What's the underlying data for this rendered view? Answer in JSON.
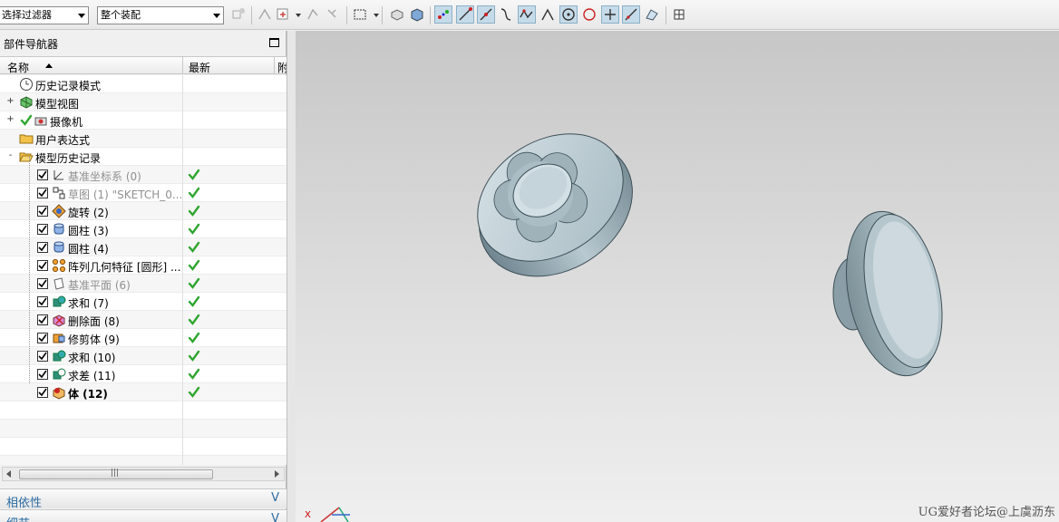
{
  "toolbar": {
    "filter_combo": "选择过滤器",
    "assembly_combo": "整个装配",
    "tools": [
      "snap-icon",
      "point-icon",
      "point-filter-icon",
      "section-icon",
      "cut-icon",
      "box-select-icon",
      "shaded-icon",
      "solid-icon",
      "endpoint-icon",
      "line-icon",
      "line-2-icon",
      "curve-icon",
      "spline-icon",
      "arc-icon",
      "circle-center-icon",
      "circle-icon",
      "cross-icon",
      "tangent-icon",
      "quadrant-icon",
      "grid-icon"
    ]
  },
  "navigator": {
    "title": "部件导航器",
    "columns": {
      "name": "名称",
      "latest": "最新",
      "extra": "附"
    },
    "items": [
      {
        "label": "历史记录模式",
        "icon": "clock-icon",
        "checkbox": false,
        "expander": "",
        "dim": false,
        "bold": false,
        "latest": false
      },
      {
        "label": "模型视图",
        "icon": "model-views-icon",
        "checkbox": false,
        "expander": "+",
        "dim": false,
        "bold": false,
        "latest": false
      },
      {
        "label": "摄像机",
        "icon": "camera-icon",
        "checkbox": false,
        "expander": "+",
        "dim": false,
        "bold": false,
        "latest": false
      },
      {
        "label": "用户表达式",
        "icon": "folder-icon",
        "checkbox": false,
        "expander": "",
        "dim": false,
        "bold": false,
        "latest": false
      },
      {
        "label": "模型历史记录",
        "icon": "folder-open-icon",
        "checkbox": false,
        "expander": "-",
        "dim": false,
        "bold": false,
        "latest": false
      },
      {
        "label": "基准坐标系 (0)",
        "icon": "datum-csys-icon",
        "checkbox": true,
        "expander": "",
        "dim": true,
        "bold": false,
        "latest": true
      },
      {
        "label": "草图 (1) \"SKETCH_0...",
        "icon": "sketch-icon",
        "checkbox": true,
        "expander": "",
        "dim": true,
        "bold": false,
        "latest": true
      },
      {
        "label": "旋转 (2)",
        "icon": "revolve-icon",
        "checkbox": true,
        "expander": "",
        "dim": false,
        "bold": false,
        "latest": true
      },
      {
        "label": "圆柱 (3)",
        "icon": "cylinder-icon",
        "checkbox": true,
        "expander": "",
        "dim": false,
        "bold": false,
        "latest": true
      },
      {
        "label": "圆柱 (4)",
        "icon": "cylinder-icon",
        "checkbox": true,
        "expander": "",
        "dim": false,
        "bold": false,
        "latest": true
      },
      {
        "label": "阵列几何特征 [圆形] ...",
        "icon": "pattern-icon",
        "checkbox": true,
        "expander": "",
        "dim": false,
        "bold": false,
        "latest": true
      },
      {
        "label": "基准平面 (6)",
        "icon": "datum-plane-icon",
        "checkbox": true,
        "expander": "",
        "dim": true,
        "bold": false,
        "latest": true
      },
      {
        "label": "求和 (7)",
        "icon": "unite-icon",
        "checkbox": true,
        "expander": "",
        "dim": false,
        "bold": false,
        "latest": true
      },
      {
        "label": "删除面 (8)",
        "icon": "delete-face-icon",
        "checkbox": true,
        "expander": "",
        "dim": false,
        "bold": false,
        "latest": true
      },
      {
        "label": "修剪体 (9)",
        "icon": "trim-body-icon",
        "checkbox": true,
        "expander": "",
        "dim": false,
        "bold": false,
        "latest": true
      },
      {
        "label": "求和 (10)",
        "icon": "unite-icon",
        "checkbox": true,
        "expander": "",
        "dim": false,
        "bold": false,
        "latest": true
      },
      {
        "label": "求差 (11)",
        "icon": "subtract-icon",
        "checkbox": true,
        "expander": "",
        "dim": false,
        "bold": false,
        "latest": true
      },
      {
        "label": "体 (12)",
        "icon": "body-icon",
        "checkbox": true,
        "expander": "",
        "dim": false,
        "bold": true,
        "latest": true
      }
    ]
  },
  "panels": {
    "dependencies": "相依性",
    "details": "细节"
  },
  "viewport": {
    "watermark": "UG爱好者论坛@上虞沥东",
    "axis_label": "X"
  },
  "colors": {
    "part": "#b6c8d0",
    "selection": "#c6dbe9",
    "check": "#2fa52f",
    "link": "#2c6ba0"
  }
}
